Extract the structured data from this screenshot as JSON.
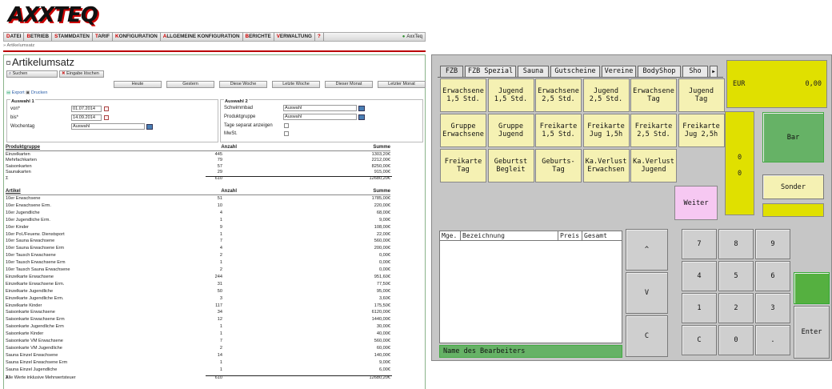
{
  "app": {
    "logo": "AXXTEQ",
    "user": "AxxTeq",
    "breadcrumb": "» Artikelumsatz"
  },
  "menu": [
    {
      "accel": "D",
      "rest": "ATEI"
    },
    {
      "accel": "B",
      "rest": "ETRIEB"
    },
    {
      "accel": "S",
      "rest": "TAMMDATEN"
    },
    {
      "accel": "T",
      "rest": "ARIF"
    },
    {
      "accel": "K",
      "rest": "ONFIGURATION"
    },
    {
      "accel": "A",
      "rest": "LLGEMEINE KONFIGURATION"
    },
    {
      "accel": "B",
      "rest": "ERICHTE"
    },
    {
      "accel": "V",
      "rest": "ERWALTUNG"
    },
    {
      "accel": "?",
      "rest": ""
    }
  ],
  "report": {
    "title": "Artikelumsatz",
    "search_label": "Suchen",
    "clear_label": "Eingabe löschen",
    "quick_ranges": [
      "Heute",
      "Gestern",
      "Diese Woche",
      "Letzte Woche",
      "Dieser Monat",
      "Letzter Monat"
    ],
    "export_label": "Export",
    "print_label": "Drucken",
    "group1": {
      "title": "Auswahl 1",
      "from_label": "von*",
      "from_value": "01.07.2014",
      "to_label": "bis*",
      "to_value": "14.09.2014",
      "weekday_label": "Wochentag",
      "weekday_value": "Auswahl"
    },
    "group2": {
      "title": "Auswahl 2",
      "pool_label": "Schwimmbad",
      "pool_value": "Auswahl",
      "pgroup_label": "Produktgruppe",
      "pgroup_value": "Auswahl",
      "separate_label": "Tage separat anzeigen",
      "vat_label": "MwSt."
    },
    "pg_table": {
      "headers": [
        "Produktgruppe",
        "Anzahl",
        "Summe"
      ],
      "rows": [
        [
          "Einzelkarten",
          "445",
          "1303,20€"
        ],
        [
          "Mehrfachkarten",
          "79",
          "2212,00€"
        ],
        [
          "Saisonkarten",
          "57",
          "8250,00€"
        ],
        [
          "Saunakarten",
          "29",
          "915,00€"
        ]
      ],
      "total": [
        "Σ",
        "610",
        "12680,20€"
      ]
    },
    "art_table": {
      "headers": [
        "Artikel",
        "Anzahl",
        "Summe"
      ],
      "rows": [
        [
          "10er Erwachsene",
          "51",
          "1785,00€"
        ],
        [
          "10er Erwachsene Erm.",
          "10",
          "220,00€"
        ],
        [
          "10er Jugendliche",
          "4",
          "68,00€"
        ],
        [
          "10er Jugendliche Erm.",
          "1",
          "9,00€"
        ],
        [
          "10er Kinder",
          "9",
          "108,00€"
        ],
        [
          "10er Pol./Feuerw. Dienstsport",
          "1",
          "22,00€"
        ],
        [
          "10er Sauna Erwachsene",
          "7",
          "560,00€"
        ],
        [
          "10er Sauna Erwachsene Erm",
          "4",
          "200,00€"
        ],
        [
          "10er Tausch Erwachsene",
          "2",
          "0,00€"
        ],
        [
          "10er Tausch Erwachsene Erm",
          "1",
          "0,00€"
        ],
        [
          "10er Tausch Sauna Erwachsene",
          "2",
          "0,00€"
        ],
        [
          "Einzelkarte Erwachsene",
          "244",
          "951,60€"
        ],
        [
          "Einzelkarte Erwachsene Erm.",
          "31",
          "77,50€"
        ],
        [
          "Einzelkarte Jugendliche",
          "50",
          "95,00€"
        ],
        [
          "Einzelkarte Jugendliche Erm.",
          "3",
          "3,60€"
        ],
        [
          "Einzelkarte Kinder",
          "117",
          "175,50€"
        ],
        [
          "Saisonkarte Erwachsene",
          "34",
          "6120,00€"
        ],
        [
          "Saisonkarte Erwachsene Erm",
          "12",
          "1440,00€"
        ],
        [
          "Saisonkarte Jugendliche Erm",
          "1",
          "30,00€"
        ],
        [
          "Saisonkarte Kinder",
          "1",
          "40,00€"
        ],
        [
          "Saisonkarte VM Erwachsene",
          "7",
          "560,00€"
        ],
        [
          "Saisonkarte VM Jugendliche",
          "2",
          "60,00€"
        ],
        [
          "Sauna Einzel Erwachsene",
          "14",
          "140,00€"
        ],
        [
          "Sauna Einzel Erwachsene Erm",
          "1",
          "9,00€"
        ],
        [
          "Sauna Einzel Jugendliche",
          "1",
          "6,00€"
        ]
      ],
      "total": [
        "Σ",
        "610",
        "12680,20€"
      ]
    },
    "footnote": "Alle Werte inklusive Mehrwertsteuer"
  },
  "pos": {
    "tabs": [
      "FZB",
      "FZB Spezial",
      "Sauna",
      "Gutscheine",
      "Vereine",
      "BodyShop",
      "Sho"
    ],
    "tab_next": "▶",
    "products": [
      [
        "Erwachsene\n1,5 Std.",
        "Jugend\n1,5 Std.",
        "Erwachsene\n2,5 Std.",
        "Jugend\n2,5 Std.",
        "Erwachsene\nTag",
        "Jugend\nTag"
      ],
      [
        "Gruppe\nErwachsene",
        "Gruppe\nJugend",
        "Freikarte\n1,5 Std.",
        "Freikarte\nJug 1,5h",
        "Freikarte\n2,5 Std.",
        "Freikarte\nJug 2,5h"
      ],
      [
        "Freikarte\nTag",
        "Geburtst\nBegleit",
        "Geburts-\nTag",
        "Ka.Verlust\nErwachsen",
        "Ka.Verlust\nJugend",
        ""
      ]
    ],
    "weiter": "Weiter",
    "display_currency": "EUR",
    "display_amount": "0,00",
    "counter_top": "0",
    "counter_bottom": "0",
    "bar_label": "Bar",
    "sonder_label": "Sonder",
    "receipt_headers": [
      "Mge.",
      "Bezeichnung",
      "Preis",
      "Gesamt"
    ],
    "nav": [
      "^",
      "V",
      "C"
    ],
    "keypad": [
      "7",
      "8",
      "9",
      "4",
      "5",
      "6",
      "1",
      "2",
      "3",
      "C",
      "0",
      "."
    ],
    "enter_label": "Enter",
    "status": "Name des Bearbeiters"
  },
  "colors": {
    "accent_red": "#cc0000",
    "pos_yellow": "#e0e000",
    "pos_green": "#66b266",
    "pos_pink": "#f6c8f2",
    "product_yellow": "#f5f1b3"
  }
}
